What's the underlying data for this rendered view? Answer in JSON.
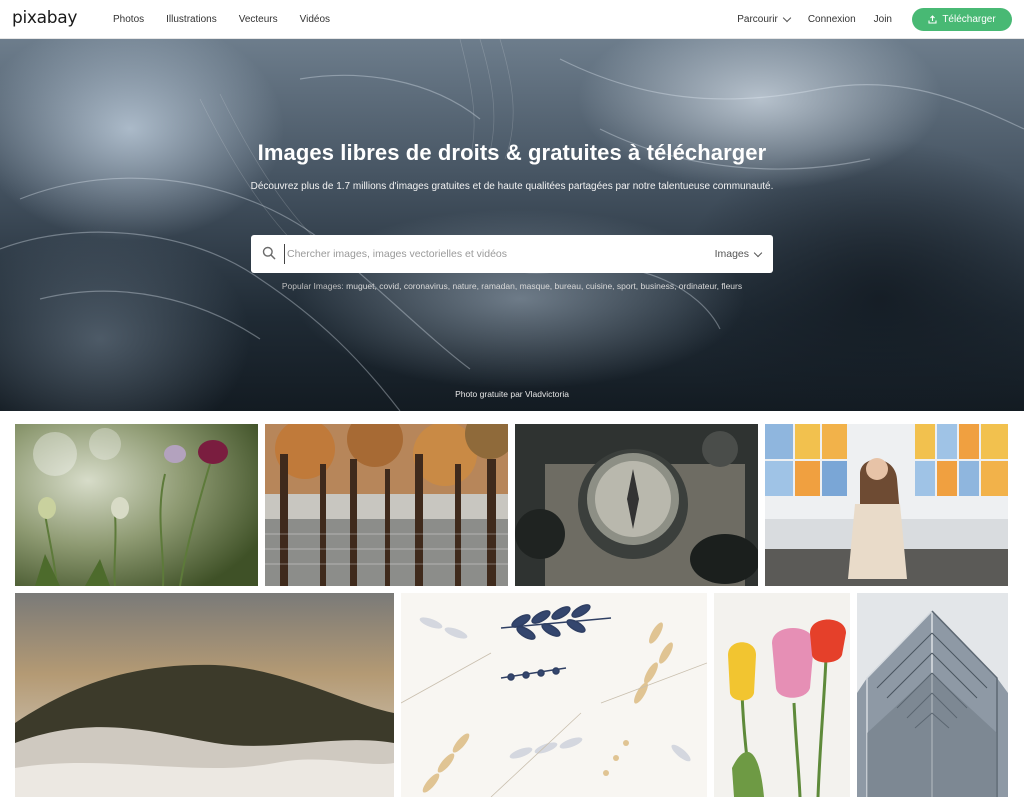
{
  "brand": {
    "logo_text": "pixabay"
  },
  "nav": {
    "left": [
      "Photos",
      "Illustrations",
      "Vecteurs",
      "Vidéos"
    ],
    "browse": "Parcourir",
    "login": "Connexion",
    "join": "Join",
    "upload": "Télécharger"
  },
  "hero": {
    "title": "Images libres de droits & gratuites à télécharger",
    "subtitle": "Découvrez plus de 1.7 millions d'images gratuites et de haute qualitées partagées par notre talentueuse communauté.",
    "search_placeholder": "Chercher images, images vectorielles et vidéos",
    "search_type": "Images",
    "popular_label": "Popular Images:",
    "popular_terms": "muguet, covid, coronavirus, nature, ramadan, masque, bureau, cuisine, sport, business, ordinateur, fleurs",
    "credit": "Photo gratuite par Vladvictoria"
  },
  "colors": {
    "accent": "#48b974",
    "header_bg": "#ffffff",
    "text": "#333333"
  },
  "icons": {
    "search": "search-icon",
    "upload": "upload-icon",
    "browse_caret": "chevron-down-icon"
  }
}
